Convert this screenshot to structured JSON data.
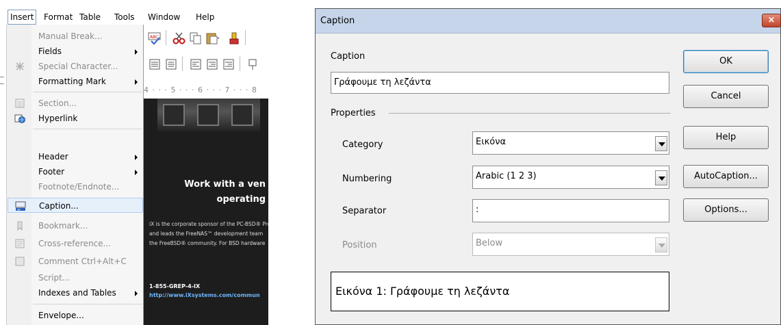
{
  "menubar": {
    "items": [
      "Insert",
      "Format",
      "Table",
      "Tools",
      "Window",
      "Help"
    ]
  },
  "insert_menu": {
    "manual_break": "Manual Break...",
    "fields": "Fields",
    "special_character": "Special Character...",
    "formatting_mark": "Formatting Mark",
    "section": "Section...",
    "hyperlink": "Hyperlink",
    "header": "Header",
    "footer": "Footer",
    "footnote_endnote": "Footnote/Endnote...",
    "caption": "Caption...",
    "bookmark": "Bookmark...",
    "cross_reference": "Cross-reference...",
    "comment": "Comment  Ctrl+Alt+C",
    "script": "Script...",
    "indexes_and_tables": "Indexes and Tables",
    "envelope": "Envelope..."
  },
  "document": {
    "ruler": "4 · · · 5 · · · 6 · · · 7 · · · 8",
    "headline_1": "Work with a ven",
    "headline_2": "operating",
    "body_line_1": "iX is the corporate sponsor of the PC-BSD® Pro",
    "body_line_2": "and leads the FreeNAS™ development team",
    "body_line_3": "the FreeBSD® community. For BSD hardware",
    "phone": "1-855-GREP-4-IX",
    "url": "http://www.iXsystems.com/commun"
  },
  "dialog": {
    "title": "Caption",
    "close_glyph": "×",
    "caption_label": "Caption",
    "caption_value": "Γράφουμε τη λεζάντα",
    "properties_label": "Properties",
    "category_label": "Category",
    "category_value": "Εικόνα",
    "numbering_label": "Numbering",
    "numbering_value": "Arabic (1 2 3)",
    "separator_label": "Separator",
    "separator_value": ":",
    "position_label": "Position",
    "position_value": "Below",
    "preview_text": "Εικόνα 1: Γράφουμε τη λεζάντα",
    "buttons": {
      "ok": "OK",
      "cancel": "Cancel",
      "help": "Help",
      "autocaption": "AutoCaption...",
      "options": "Options..."
    }
  }
}
